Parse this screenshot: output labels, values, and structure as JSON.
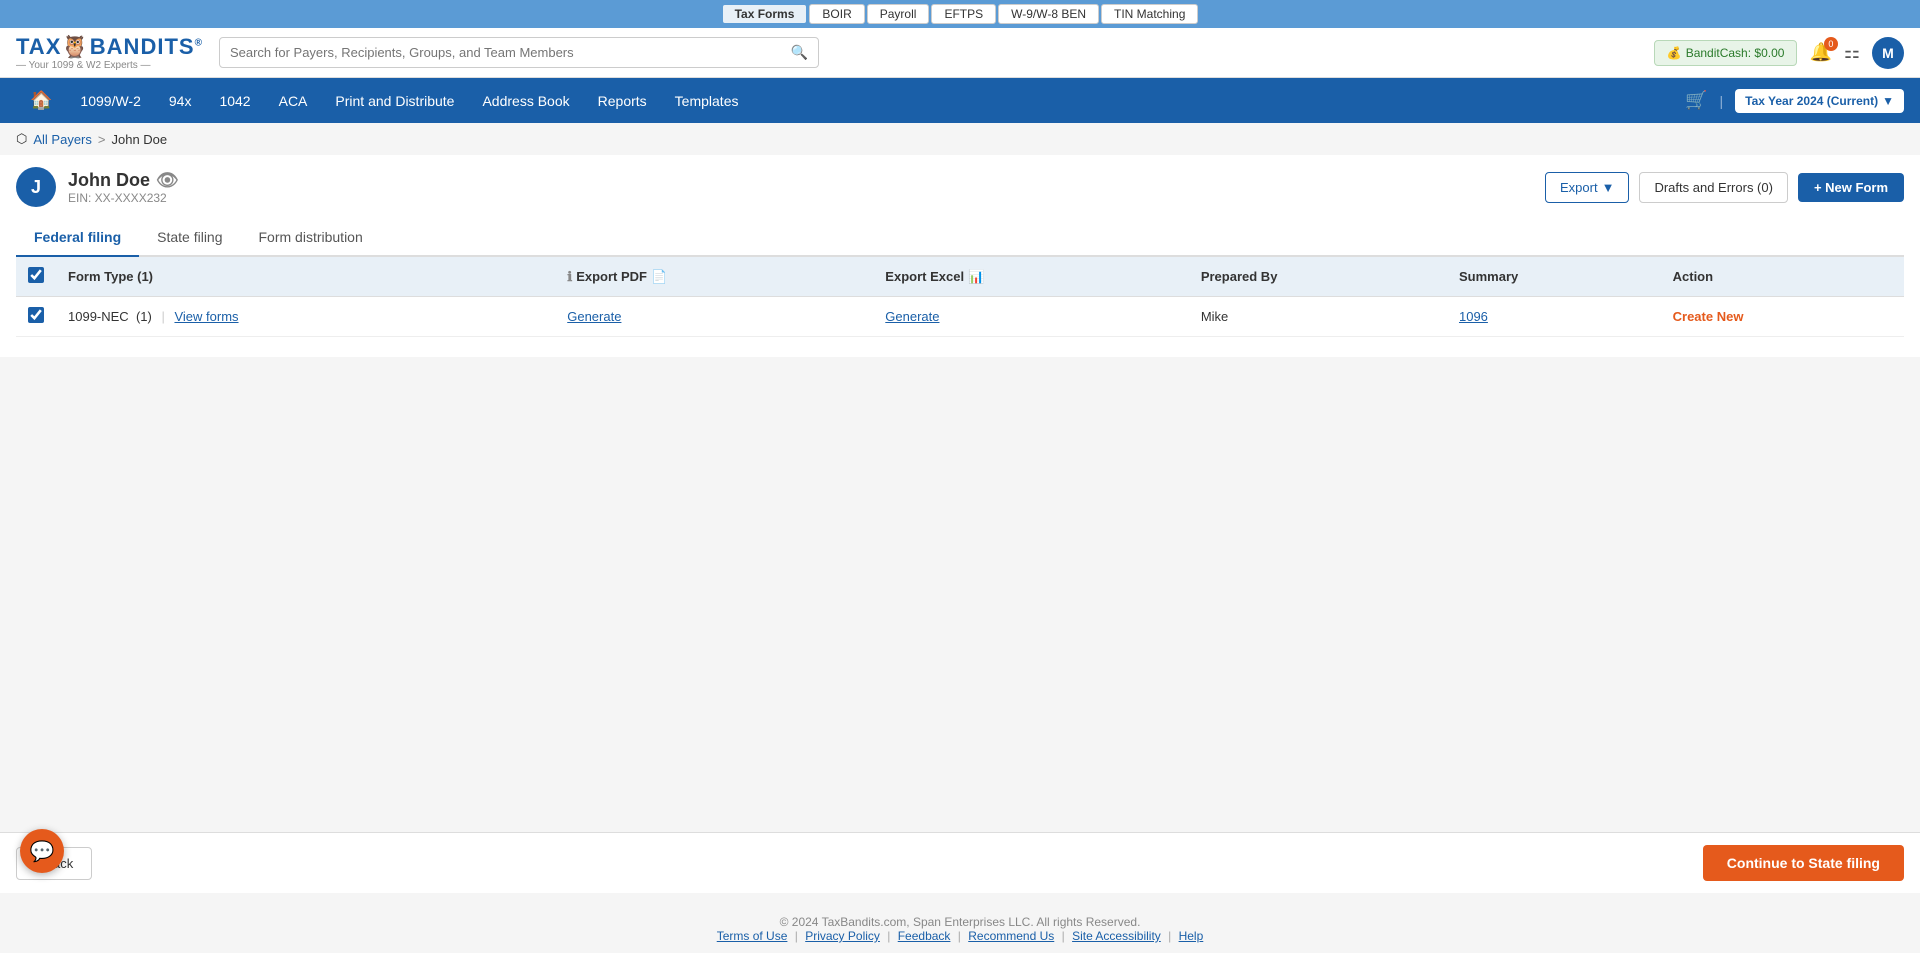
{
  "topBar": {
    "items": [
      {
        "id": "tax-forms",
        "label": "Tax Forms",
        "active": true
      },
      {
        "id": "boir",
        "label": "BOIR",
        "active": false
      },
      {
        "id": "payroll",
        "label": "Payroll",
        "active": false
      },
      {
        "id": "eftps",
        "label": "EFTPS",
        "active": false
      },
      {
        "id": "w9-w8-ben",
        "label": "W-9/W-8 BEN",
        "active": false
      },
      {
        "id": "tin-matching",
        "label": "TIN Matching",
        "active": false
      }
    ]
  },
  "header": {
    "logo": "TAXBANDITS",
    "logo_reg": "®",
    "subtitle": "— Your 1099 & W2 Experts —",
    "search_placeholder": "Search for Payers, Recipients, Groups, and Team Members",
    "bandit_cash_label": "BanditCash: $0.00",
    "notification_count": "0",
    "avatar_initial": "M"
  },
  "mainNav": {
    "items": [
      {
        "id": "home",
        "label": "🏠",
        "isHome": true
      },
      {
        "id": "1099-w2",
        "label": "1099/W-2"
      },
      {
        "id": "94x",
        "label": "94x"
      },
      {
        "id": "1042",
        "label": "1042"
      },
      {
        "id": "aca",
        "label": "ACA"
      },
      {
        "id": "print-distribute",
        "label": "Print and Distribute"
      },
      {
        "id": "address-book",
        "label": "Address Book"
      },
      {
        "id": "reports",
        "label": "Reports"
      },
      {
        "id": "templates",
        "label": "Templates"
      }
    ],
    "tax_year": "Tax Year 2024 (Current)"
  },
  "breadcrumb": {
    "allPayers": "All Payers",
    "separator": ">",
    "current": "John Doe"
  },
  "payer": {
    "initial": "J",
    "name": "John Doe",
    "ein": "EIN: XX-XXXX232"
  },
  "toolbar": {
    "export_label": "Export",
    "drafts_label": "Drafts and Errors (0)",
    "new_form_label": "+ New Form"
  },
  "tabs": [
    {
      "id": "federal-filing",
      "label": "Federal filing",
      "active": true
    },
    {
      "id": "state-filing",
      "label": "State filing",
      "active": false
    },
    {
      "id": "form-distribution",
      "label": "Form distribution",
      "active": false
    }
  ],
  "table": {
    "headers": {
      "form_type": "Form Type",
      "form_count": "(1)",
      "export_pdf": "Export PDF",
      "export_excel": "Export Excel",
      "prepared_by": "Prepared By",
      "summary": "Summary",
      "action": "Action"
    },
    "rows": [
      {
        "form_type": "1099-NEC",
        "count": "(1)",
        "view_forms": "View forms",
        "export_pdf_link": "Generate",
        "export_excel_link": "Generate",
        "prepared_by": "Mike",
        "summary_link": "1096",
        "action_link": "Create New"
      }
    ]
  },
  "bottomBar": {
    "back_label": "Back",
    "continue_label": "Continue to State filing"
  },
  "footer": {
    "copyright": "© 2024 TaxBandits.com, Span Enterprises LLC. All rights Reserved.",
    "links": [
      {
        "id": "terms",
        "label": "Terms of Use"
      },
      {
        "id": "privacy",
        "label": "Privacy Policy"
      },
      {
        "id": "feedback",
        "label": "Feedback"
      },
      {
        "id": "recommend",
        "label": "Recommend Us"
      },
      {
        "id": "accessibility",
        "label": "Site Accessibility"
      },
      {
        "id": "help",
        "label": "Help"
      }
    ]
  }
}
